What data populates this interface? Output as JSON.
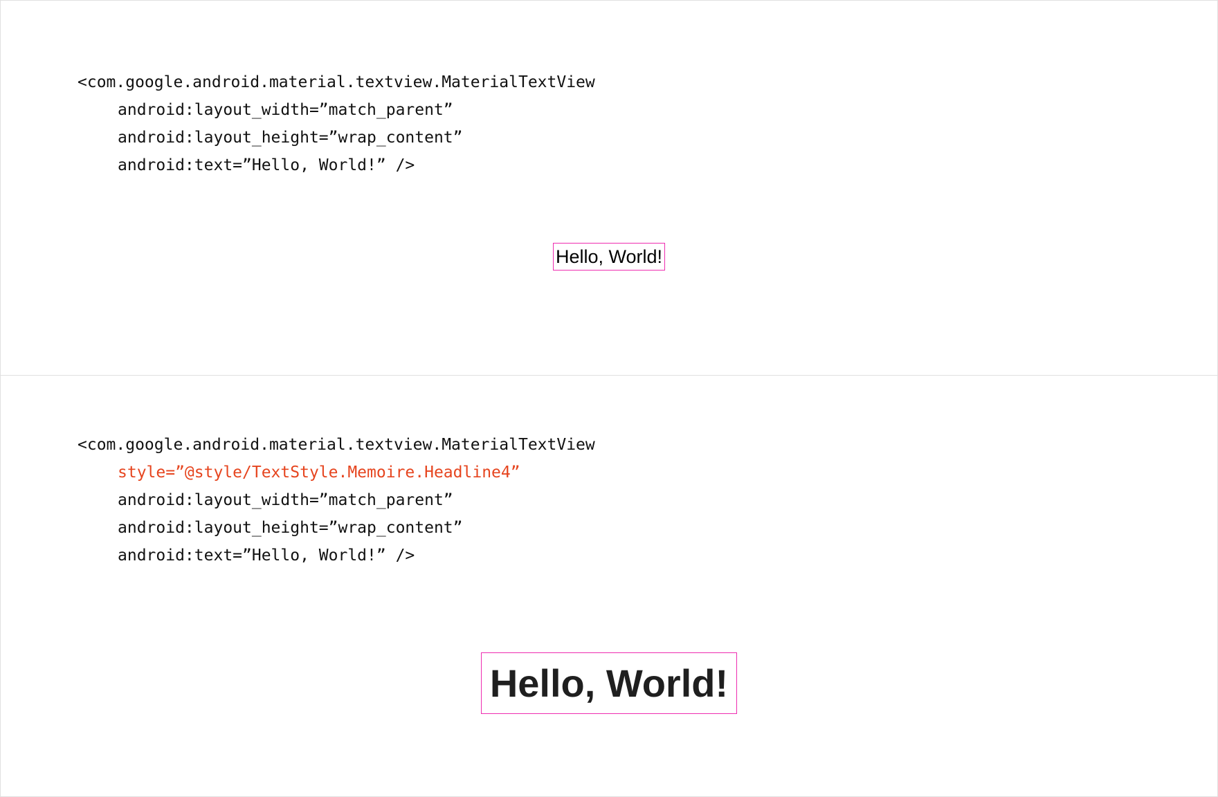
{
  "panels": [
    {
      "code_lines": [
        "<com.google.android.material.textview.MaterialTextView",
        "android:layout_width=”match_parent”",
        "android:layout_height=”wrap_content”",
        "android:text=”Hello, World!” />"
      ],
      "preview_text": "Hello, World!"
    },
    {
      "code_lines": [
        "<com.google.android.material.textview.MaterialTextView",
        "style=”@style/TextStyle.Memoire.Headline4”",
        "android:layout_width=”match_parent”",
        "android:layout_height=”wrap_content”",
        "android:text=”Hello, World!” />"
      ],
      "preview_text": "Hello, World!"
    }
  ],
  "colors": {
    "highlight": "#e6451f",
    "preview_border": "#ee2bb0",
    "divider": "#e0e0e0"
  }
}
